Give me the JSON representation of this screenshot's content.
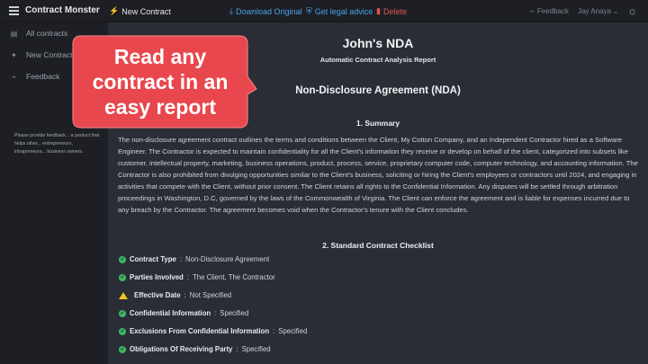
{
  "topbar": {
    "brand": "Contract Monster",
    "new_contract": "New Contract",
    "download": "Download Original",
    "legal_advice": "Get legal advice",
    "delete": "Delete",
    "feedback": "Feedback",
    "user": "Jay Anaya"
  },
  "sidebar": {
    "items": [
      {
        "label": "All contracts",
        "icon": "document-icon"
      },
      {
        "label": "New Contract",
        "icon": "wand-icon"
      },
      {
        "label": "Feedback",
        "icon": "megaphone-icon"
      }
    ],
    "note": "Please provide feedback... a product that helps other... entrepreneurs, intrapreneurs... business owners."
  },
  "callout": {
    "line1": "Read any",
    "line2": "contract in an",
    "line3": "easy report",
    "color": "#e8474d"
  },
  "report": {
    "title": "John's NDA",
    "subtitle": "Automatic Contract Analysis Report",
    "contract_type": "Non-Disclosure Agreement (NDA)",
    "summary_heading": "1. Summary",
    "summary_text": "The non-disclosure agreement contract outlines the terms and conditions between the Client, My Cotton Company, and an Independent Contractor hired as a Software Engineer. The Contractor is expected to maintain confidentiality for all the Client's information they receive or develop on behalf of the client, categorized into subsets like customer, intellectual property, marketing, business operations, product, process, service, proprietary computer code, computer technology, and accounting information. The Contractor is also prohibited from divulging opportunities similar to the Client's business, soliciting or hiring the Client's employees or contractors until 2024, and engaging in activities that compete with the Client, without prior consent. The Client retains all rights to the Confidential Information. Any disputes will be settled through arbitration proceedings in Washington, D.C, governed by the laws of the Commonwealth of Virginia. The Client can enforce the agreement and is liable for expenses incurred due to any breach by the Contractor. The agreement becomes void when the Contractor's tenure with the Client concludes.",
    "checklist_heading": "2. Standard Contract Checklist",
    "checklist": [
      {
        "label": "Contract Type",
        "value": "Non-Disclosure Agreement",
        "status": "ok"
      },
      {
        "label": "Parties Involved",
        "value": "The Client, The Contractor",
        "status": "ok"
      },
      {
        "label": "Effective Date",
        "value": "Not Specified",
        "status": "warning"
      },
      {
        "label": "Confidential Information",
        "value": "Specified",
        "status": "ok"
      },
      {
        "label": "Exclusions From Confidential Information",
        "value": "Specified",
        "status": "ok"
      },
      {
        "label": "Obligations Of Receiving Party",
        "value": "Specified",
        "status": "ok"
      }
    ]
  },
  "colors": {
    "link": "#4aa3e8",
    "delete": "#e05757",
    "ok": "#3db865",
    "warning": "#f1c21b"
  }
}
